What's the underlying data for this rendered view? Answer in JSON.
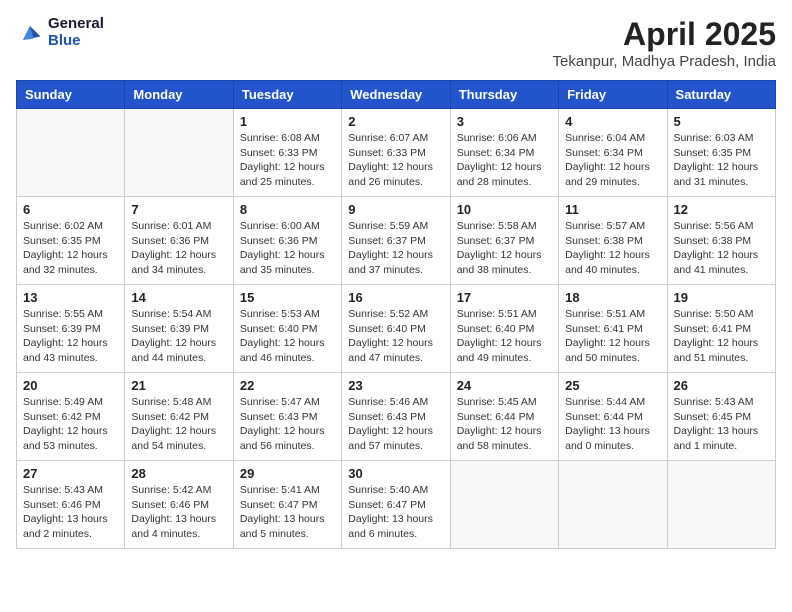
{
  "logo": {
    "general": "General",
    "blue": "Blue"
  },
  "header": {
    "month": "April 2025",
    "location": "Tekanpur, Madhya Pradesh, India"
  },
  "weekdays": [
    "Sunday",
    "Monday",
    "Tuesday",
    "Wednesday",
    "Thursday",
    "Friday",
    "Saturday"
  ],
  "weeks": [
    [
      {
        "day": "",
        "info": ""
      },
      {
        "day": "",
        "info": ""
      },
      {
        "day": "1",
        "info": "Sunrise: 6:08 AM\nSunset: 6:33 PM\nDaylight: 12 hours and 25 minutes."
      },
      {
        "day": "2",
        "info": "Sunrise: 6:07 AM\nSunset: 6:33 PM\nDaylight: 12 hours and 26 minutes."
      },
      {
        "day": "3",
        "info": "Sunrise: 6:06 AM\nSunset: 6:34 PM\nDaylight: 12 hours and 28 minutes."
      },
      {
        "day": "4",
        "info": "Sunrise: 6:04 AM\nSunset: 6:34 PM\nDaylight: 12 hours and 29 minutes."
      },
      {
        "day": "5",
        "info": "Sunrise: 6:03 AM\nSunset: 6:35 PM\nDaylight: 12 hours and 31 minutes."
      }
    ],
    [
      {
        "day": "6",
        "info": "Sunrise: 6:02 AM\nSunset: 6:35 PM\nDaylight: 12 hours and 32 minutes."
      },
      {
        "day": "7",
        "info": "Sunrise: 6:01 AM\nSunset: 6:36 PM\nDaylight: 12 hours and 34 minutes."
      },
      {
        "day": "8",
        "info": "Sunrise: 6:00 AM\nSunset: 6:36 PM\nDaylight: 12 hours and 35 minutes."
      },
      {
        "day": "9",
        "info": "Sunrise: 5:59 AM\nSunset: 6:37 PM\nDaylight: 12 hours and 37 minutes."
      },
      {
        "day": "10",
        "info": "Sunrise: 5:58 AM\nSunset: 6:37 PM\nDaylight: 12 hours and 38 minutes."
      },
      {
        "day": "11",
        "info": "Sunrise: 5:57 AM\nSunset: 6:38 PM\nDaylight: 12 hours and 40 minutes."
      },
      {
        "day": "12",
        "info": "Sunrise: 5:56 AM\nSunset: 6:38 PM\nDaylight: 12 hours and 41 minutes."
      }
    ],
    [
      {
        "day": "13",
        "info": "Sunrise: 5:55 AM\nSunset: 6:39 PM\nDaylight: 12 hours and 43 minutes."
      },
      {
        "day": "14",
        "info": "Sunrise: 5:54 AM\nSunset: 6:39 PM\nDaylight: 12 hours and 44 minutes."
      },
      {
        "day": "15",
        "info": "Sunrise: 5:53 AM\nSunset: 6:40 PM\nDaylight: 12 hours and 46 minutes."
      },
      {
        "day": "16",
        "info": "Sunrise: 5:52 AM\nSunset: 6:40 PM\nDaylight: 12 hours and 47 minutes."
      },
      {
        "day": "17",
        "info": "Sunrise: 5:51 AM\nSunset: 6:40 PM\nDaylight: 12 hours and 49 minutes."
      },
      {
        "day": "18",
        "info": "Sunrise: 5:51 AM\nSunset: 6:41 PM\nDaylight: 12 hours and 50 minutes."
      },
      {
        "day": "19",
        "info": "Sunrise: 5:50 AM\nSunset: 6:41 PM\nDaylight: 12 hours and 51 minutes."
      }
    ],
    [
      {
        "day": "20",
        "info": "Sunrise: 5:49 AM\nSunset: 6:42 PM\nDaylight: 12 hours and 53 minutes."
      },
      {
        "day": "21",
        "info": "Sunrise: 5:48 AM\nSunset: 6:42 PM\nDaylight: 12 hours and 54 minutes."
      },
      {
        "day": "22",
        "info": "Sunrise: 5:47 AM\nSunset: 6:43 PM\nDaylight: 12 hours and 56 minutes."
      },
      {
        "day": "23",
        "info": "Sunrise: 5:46 AM\nSunset: 6:43 PM\nDaylight: 12 hours and 57 minutes."
      },
      {
        "day": "24",
        "info": "Sunrise: 5:45 AM\nSunset: 6:44 PM\nDaylight: 12 hours and 58 minutes."
      },
      {
        "day": "25",
        "info": "Sunrise: 5:44 AM\nSunset: 6:44 PM\nDaylight: 13 hours and 0 minutes."
      },
      {
        "day": "26",
        "info": "Sunrise: 5:43 AM\nSunset: 6:45 PM\nDaylight: 13 hours and 1 minute."
      }
    ],
    [
      {
        "day": "27",
        "info": "Sunrise: 5:43 AM\nSunset: 6:46 PM\nDaylight: 13 hours and 2 minutes."
      },
      {
        "day": "28",
        "info": "Sunrise: 5:42 AM\nSunset: 6:46 PM\nDaylight: 13 hours and 4 minutes."
      },
      {
        "day": "29",
        "info": "Sunrise: 5:41 AM\nSunset: 6:47 PM\nDaylight: 13 hours and 5 minutes."
      },
      {
        "day": "30",
        "info": "Sunrise: 5:40 AM\nSunset: 6:47 PM\nDaylight: 13 hours and 6 minutes."
      },
      {
        "day": "",
        "info": ""
      },
      {
        "day": "",
        "info": ""
      },
      {
        "day": "",
        "info": ""
      }
    ]
  ]
}
